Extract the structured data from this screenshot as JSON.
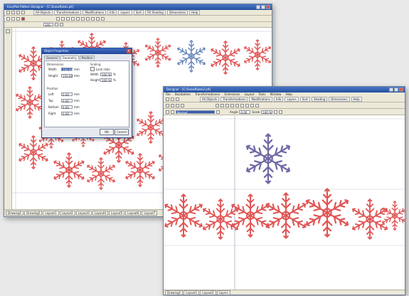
{
  "colors": {
    "pattern_red": "#e05656",
    "pattern_blue": "#6a88bc",
    "pattern_purple": "#6f6aa6",
    "accent": "#2c5aa8"
  },
  "back_window": {
    "title": "EasyPlot Pattern Designer - [C:\\Snowflakes.plt]",
    "toolbar_tabs": [
      "All Objects",
      "Transformations",
      "Modifications",
      "Info",
      "Layers",
      "Sort",
      "Fill Shading",
      "Dimensions",
      "Help"
    ],
    "zoom_value": "100",
    "status_tabs": [
      "Drawing1",
      "Drawing2",
      "Layout1",
      "Layout2",
      "Layout3",
      "Layout4",
      "Layout5",
      "Layout6",
      "Layout7"
    ]
  },
  "dialog": {
    "title": "Object Properties",
    "tabs": [
      "General",
      "Geometry",
      "Position"
    ],
    "group_size": "Dimensions",
    "group_scale": "Scaling",
    "lock_label": "Lock ratio",
    "fields": [
      {
        "label": "Width",
        "value": "200.00",
        "unit": "mm"
      },
      {
        "label": "Height",
        "value": "150.00",
        "unit": "mm"
      }
    ],
    "scale_fields": [
      {
        "label": "Width",
        "value": "100 %",
        "unit": "%"
      },
      {
        "label": "Height",
        "value": "100 %",
        "unit": "%"
      }
    ],
    "group_pos": "Position",
    "pos_fields": [
      {
        "label": "Left",
        "value": "0.00",
        "unit": "mm"
      },
      {
        "label": "Top",
        "value": "0.00",
        "unit": "mm"
      },
      {
        "label": "Bottom",
        "value": "0.00",
        "unit": "mm"
      },
      {
        "label": "Right",
        "value": "0.00",
        "unit": "mm"
      }
    ],
    "ok_label": "OK",
    "cancel_label": "Cancel"
  },
  "front_window": {
    "title": "Designer - [C:\\Snowflakes2.plt]",
    "menu": [
      "File",
      "Bearbeiten",
      "Transformationen",
      "Extensions",
      "Layout",
      "Tools",
      "Window",
      "Help"
    ],
    "toolbar_tabs": [
      "All Objects",
      "Transformations",
      "Modifications",
      "Info",
      "Layers",
      "Sort",
      "Shading",
      "Dimensions",
      "Help"
    ],
    "font_value": "Normal",
    "angle_label": "Angle",
    "angle_value": "0.00",
    "scale_label": "Scale",
    "scale_value": "100 %",
    "status_tabs": [
      "Drawing1",
      "Layout1",
      "Layout2",
      "Layers"
    ]
  }
}
